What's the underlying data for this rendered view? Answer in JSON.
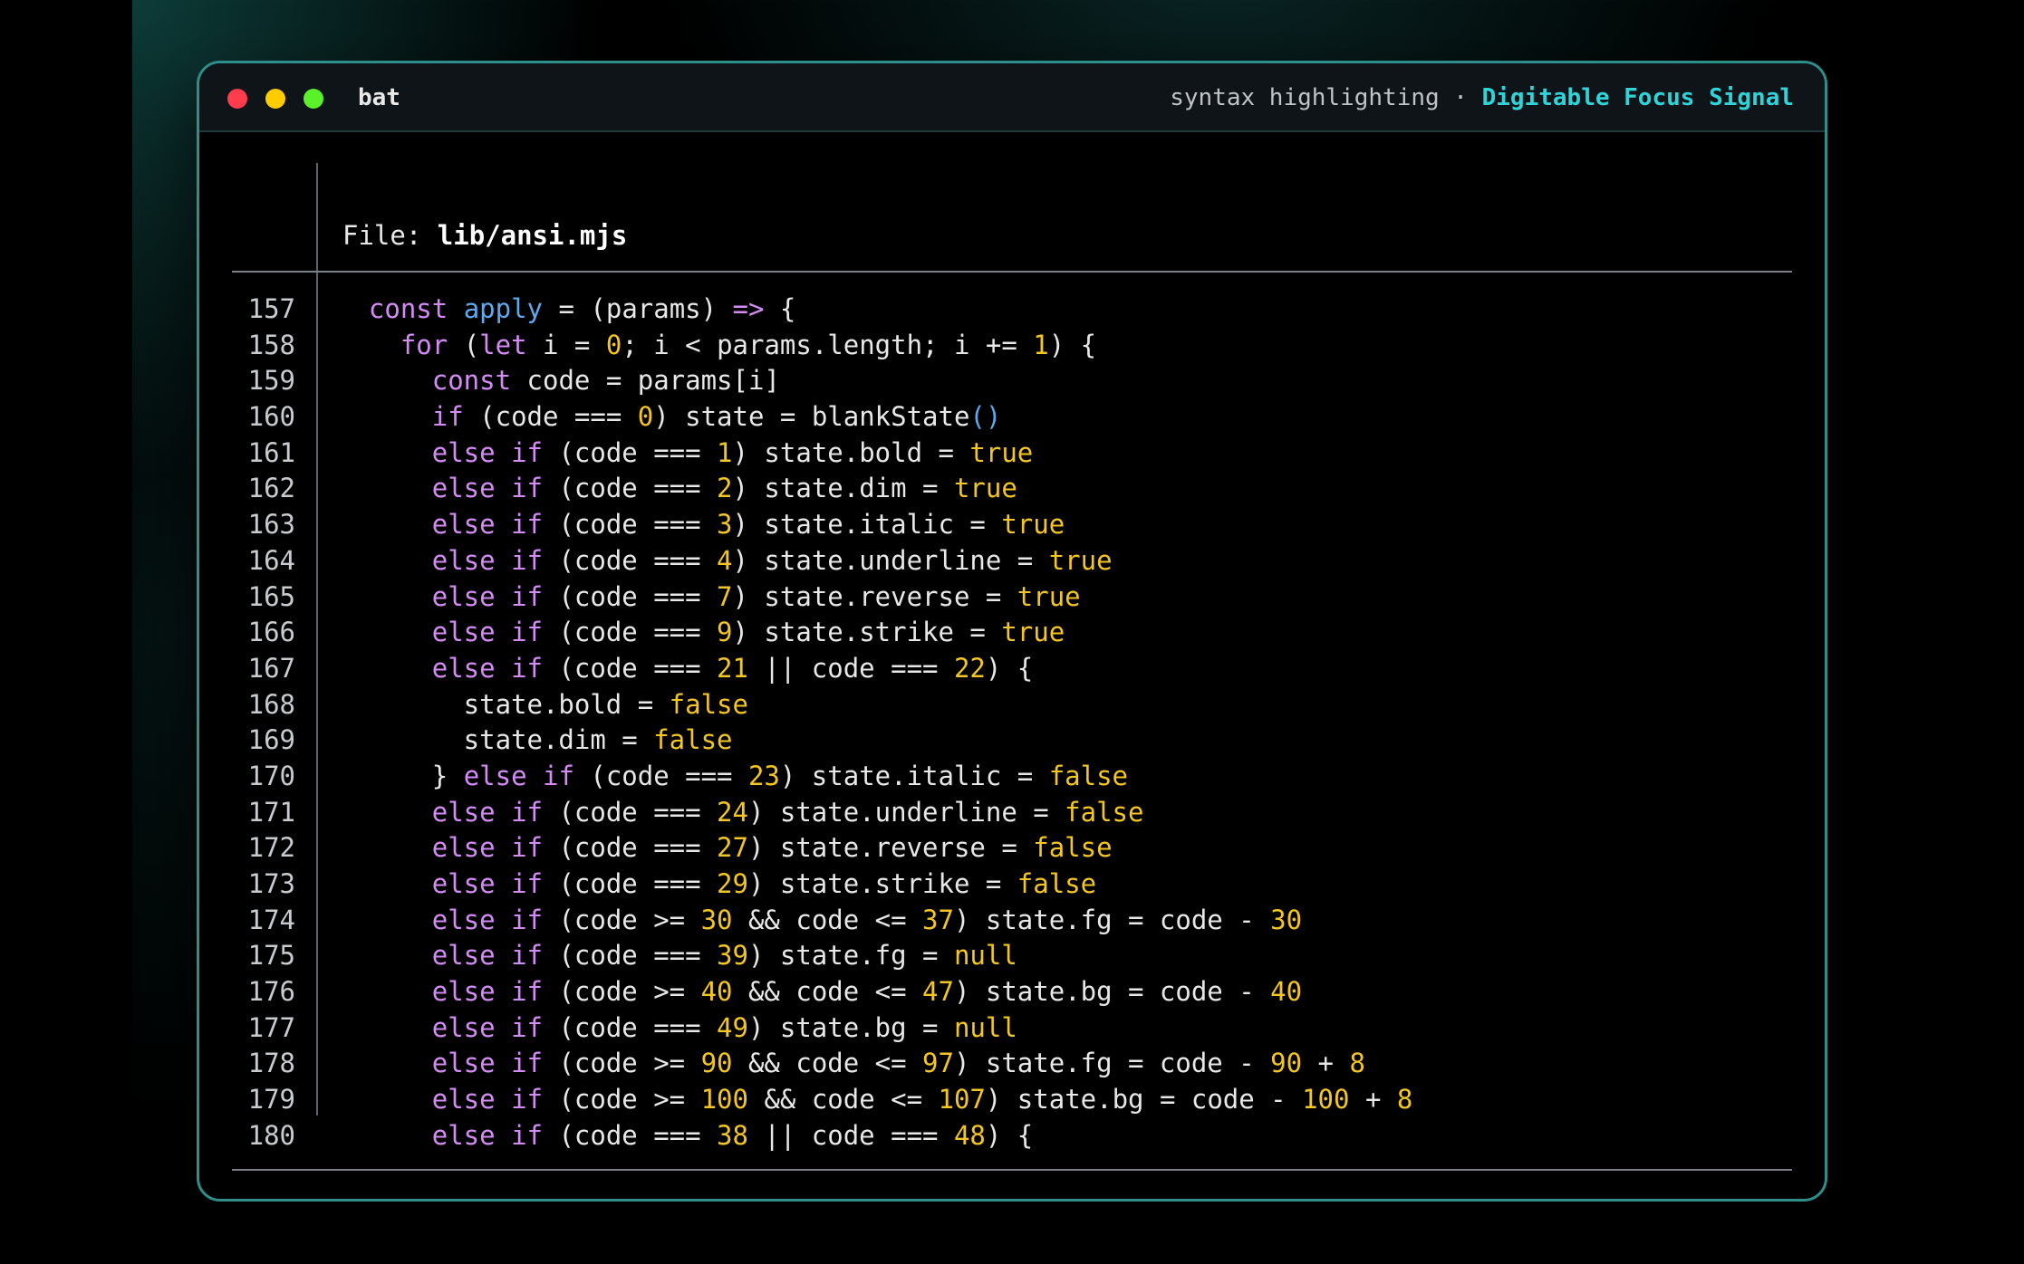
{
  "window": {
    "app_name": "bat",
    "subtitle": "syntax highlighting ·",
    "brand": "Digitable Focus Signal"
  },
  "file": {
    "label": "File:",
    "name": "lib/ansi.mjs"
  },
  "colors": {
    "keyword": "#d58bf5",
    "function": "#5fa8ec",
    "number": "#f3c623",
    "text": "#e8e8e8",
    "brand": "#2fd3d8",
    "border": "#2e8f8a"
  },
  "code_lines": [
    {
      "n": "157",
      "t": [
        [
          "",
          "  "
        ],
        [
          "kw",
          "const"
        ],
        [
          "",
          " "
        ],
        [
          "fn",
          "apply"
        ],
        [
          "",
          " = (params) "
        ],
        [
          "kw",
          "=>"
        ],
        [
          "",
          " {"
        ]
      ]
    },
    {
      "n": "158",
      "t": [
        [
          "",
          "    "
        ],
        [
          "kw",
          "for"
        ],
        [
          "",
          " ("
        ],
        [
          "kw",
          "let"
        ],
        [
          "",
          " i = "
        ],
        [
          "num",
          "0"
        ],
        [
          "",
          "; i < params.length; i += "
        ],
        [
          "num",
          "1"
        ],
        [
          "",
          ") {"
        ]
      ]
    },
    {
      "n": "159",
      "t": [
        [
          "",
          "      "
        ],
        [
          "kw",
          "const"
        ],
        [
          "",
          " code = params[i]"
        ]
      ]
    },
    {
      "n": "160",
      "t": [
        [
          "",
          "      "
        ],
        [
          "kw",
          "if"
        ],
        [
          "",
          " (code === "
        ],
        [
          "num",
          "0"
        ],
        [
          "",
          ") state = blankState"
        ],
        [
          "fn",
          "()"
        ]
      ]
    },
    {
      "n": "161",
      "t": [
        [
          "",
          "      "
        ],
        [
          "kw",
          "else if"
        ],
        [
          "",
          " (code === "
        ],
        [
          "num",
          "1"
        ],
        [
          "",
          ") state.bold = "
        ],
        [
          "num",
          "true"
        ]
      ]
    },
    {
      "n": "162",
      "t": [
        [
          "",
          "      "
        ],
        [
          "kw",
          "else if"
        ],
        [
          "",
          " (code === "
        ],
        [
          "num",
          "2"
        ],
        [
          "",
          ") state.dim = "
        ],
        [
          "num",
          "true"
        ]
      ]
    },
    {
      "n": "163",
      "t": [
        [
          "",
          "      "
        ],
        [
          "kw",
          "else if"
        ],
        [
          "",
          " (code === "
        ],
        [
          "num",
          "3"
        ],
        [
          "",
          ") state.italic = "
        ],
        [
          "num",
          "true"
        ]
      ]
    },
    {
      "n": "164",
      "t": [
        [
          "",
          "      "
        ],
        [
          "kw",
          "else if"
        ],
        [
          "",
          " (code === "
        ],
        [
          "num",
          "4"
        ],
        [
          "",
          ") state.underline = "
        ],
        [
          "num",
          "true"
        ]
      ]
    },
    {
      "n": "165",
      "t": [
        [
          "",
          "      "
        ],
        [
          "kw",
          "else if"
        ],
        [
          "",
          " (code === "
        ],
        [
          "num",
          "7"
        ],
        [
          "",
          ") state.reverse = "
        ],
        [
          "num",
          "true"
        ]
      ]
    },
    {
      "n": "166",
      "t": [
        [
          "",
          "      "
        ],
        [
          "kw",
          "else if"
        ],
        [
          "",
          " (code === "
        ],
        [
          "num",
          "9"
        ],
        [
          "",
          ") state.strike = "
        ],
        [
          "num",
          "true"
        ]
      ]
    },
    {
      "n": "167",
      "t": [
        [
          "",
          "      "
        ],
        [
          "kw",
          "else if"
        ],
        [
          "",
          " (code === "
        ],
        [
          "num",
          "21"
        ],
        [
          "",
          " || code === "
        ],
        [
          "num",
          "22"
        ],
        [
          "",
          ") {"
        ]
      ]
    },
    {
      "n": "168",
      "t": [
        [
          "",
          "        state.bold = "
        ],
        [
          "num",
          "false"
        ]
      ]
    },
    {
      "n": "169",
      "t": [
        [
          "",
          "        state.dim = "
        ],
        [
          "num",
          "false"
        ]
      ]
    },
    {
      "n": "170",
      "t": [
        [
          "",
          "      } "
        ],
        [
          "kw",
          "else if"
        ],
        [
          "",
          " (code === "
        ],
        [
          "num",
          "23"
        ],
        [
          "",
          ") state.italic = "
        ],
        [
          "num",
          "false"
        ]
      ]
    },
    {
      "n": "171",
      "t": [
        [
          "",
          "      "
        ],
        [
          "kw",
          "else if"
        ],
        [
          "",
          " (code === "
        ],
        [
          "num",
          "24"
        ],
        [
          "",
          ") state.underline = "
        ],
        [
          "num",
          "false"
        ]
      ]
    },
    {
      "n": "172",
      "t": [
        [
          "",
          "      "
        ],
        [
          "kw",
          "else if"
        ],
        [
          "",
          " (code === "
        ],
        [
          "num",
          "27"
        ],
        [
          "",
          ") state.reverse = "
        ],
        [
          "num",
          "false"
        ]
      ]
    },
    {
      "n": "173",
      "t": [
        [
          "",
          "      "
        ],
        [
          "kw",
          "else if"
        ],
        [
          "",
          " (code === "
        ],
        [
          "num",
          "29"
        ],
        [
          "",
          ") state.strike = "
        ],
        [
          "num",
          "false"
        ]
      ]
    },
    {
      "n": "174",
      "t": [
        [
          "",
          "      "
        ],
        [
          "kw",
          "else if"
        ],
        [
          "",
          " (code >= "
        ],
        [
          "num",
          "30"
        ],
        [
          "",
          " && code <= "
        ],
        [
          "num",
          "37"
        ],
        [
          "",
          ") state.fg = code - "
        ],
        [
          "num",
          "30"
        ]
      ]
    },
    {
      "n": "175",
      "t": [
        [
          "",
          "      "
        ],
        [
          "kw",
          "else if"
        ],
        [
          "",
          " (code === "
        ],
        [
          "num",
          "39"
        ],
        [
          "",
          ") state.fg = "
        ],
        [
          "num",
          "null"
        ]
      ]
    },
    {
      "n": "176",
      "t": [
        [
          "",
          "      "
        ],
        [
          "kw",
          "else if"
        ],
        [
          "",
          " (code >= "
        ],
        [
          "num",
          "40"
        ],
        [
          "",
          " && code <= "
        ],
        [
          "num",
          "47"
        ],
        [
          "",
          ") state.bg = code - "
        ],
        [
          "num",
          "40"
        ]
      ]
    },
    {
      "n": "177",
      "t": [
        [
          "",
          "      "
        ],
        [
          "kw",
          "else if"
        ],
        [
          "",
          " (code === "
        ],
        [
          "num",
          "49"
        ],
        [
          "",
          ") state.bg = "
        ],
        [
          "num",
          "null"
        ]
      ]
    },
    {
      "n": "178",
      "t": [
        [
          "",
          "      "
        ],
        [
          "kw",
          "else if"
        ],
        [
          "",
          " (code >= "
        ],
        [
          "num",
          "90"
        ],
        [
          "",
          " && code <= "
        ],
        [
          "num",
          "97"
        ],
        [
          "",
          ") state.fg = code - "
        ],
        [
          "num",
          "90"
        ],
        [
          "",
          " + "
        ],
        [
          "num",
          "8"
        ]
      ]
    },
    {
      "n": "179",
      "t": [
        [
          "",
          "      "
        ],
        [
          "kw",
          "else if"
        ],
        [
          "",
          " (code >= "
        ],
        [
          "num",
          "100"
        ],
        [
          "",
          " && code <= "
        ],
        [
          "num",
          "107"
        ],
        [
          "",
          ") state.bg = code - "
        ],
        [
          "num",
          "100"
        ],
        [
          "",
          " + "
        ],
        [
          "num",
          "8"
        ]
      ]
    },
    {
      "n": "180",
      "t": [
        [
          "",
          "      "
        ],
        [
          "kw",
          "else if"
        ],
        [
          "",
          " (code === "
        ],
        [
          "num",
          "38"
        ],
        [
          "",
          " || code === "
        ],
        [
          "num",
          "48"
        ],
        [
          "",
          ") {"
        ]
      ]
    }
  ]
}
